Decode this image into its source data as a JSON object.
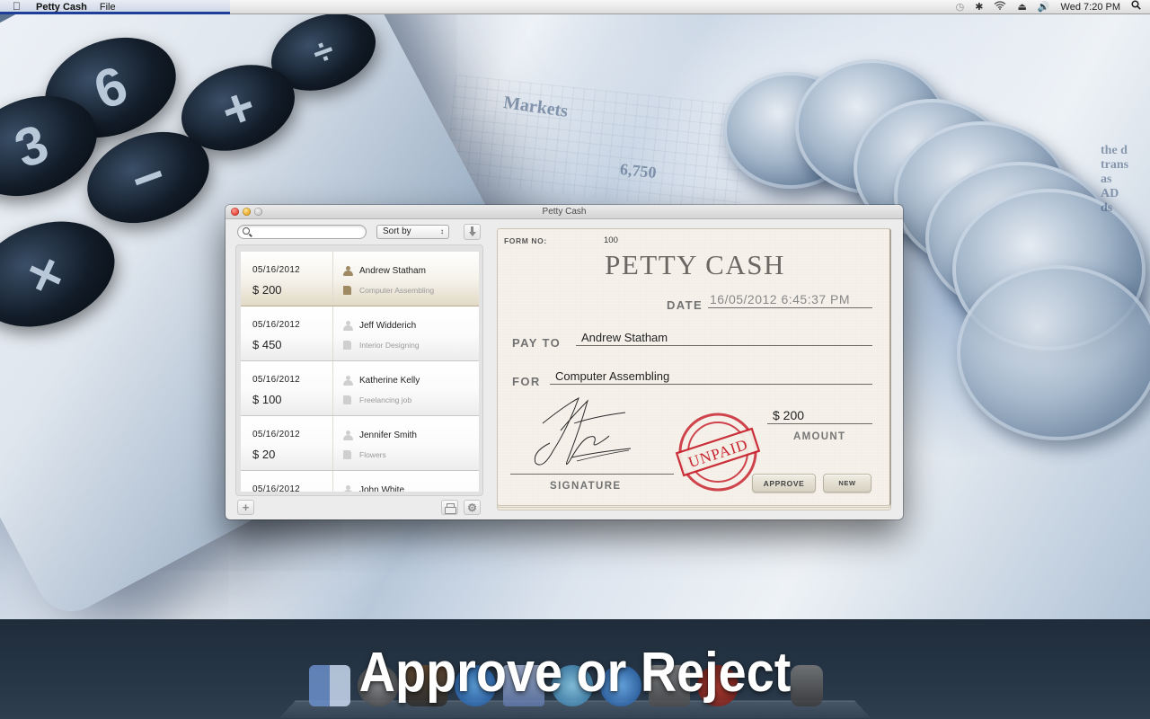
{
  "menubar": {
    "app_name": "Petty Cash",
    "menus": [
      "File"
    ],
    "status_icons": [
      "time-machine-icon",
      "bluetooth-icon",
      "wifi-icon",
      "eject-icon",
      "volume-icon"
    ],
    "clock": "Wed 7:20 PM",
    "spotlight_icon": "search-icon"
  },
  "window": {
    "title": "Petty Cash",
    "search": {
      "placeholder": "",
      "value": ""
    },
    "sort": {
      "selected": "Sort by"
    },
    "entries": [
      {
        "date": "05/16/2012",
        "amount": "$ 200",
        "name": "Andrew Statham",
        "memo": "Computer Assembling",
        "selected": true
      },
      {
        "date": "05/16/2012",
        "amount": "$ 450",
        "name": "Jeff Widderich",
        "memo": "Interior Designing",
        "selected": false
      },
      {
        "date": "05/16/2012",
        "amount": "$ 100",
        "name": "Katherine Kelly",
        "memo": "Freelancing job",
        "selected": false
      },
      {
        "date": "05/16/2012",
        "amount": "$ 20",
        "name": "Jennifer Smith",
        "memo": "Flowers",
        "selected": false
      },
      {
        "date": "05/16/2012",
        "amount": "",
        "name": "John White",
        "memo": "",
        "selected": false
      }
    ],
    "voucher": {
      "form_no_label": "FORM NO:",
      "form_no": "100",
      "title": "PETTY CASH",
      "date_label": "DATE",
      "date_value": "16/05/2012   6:45:37 PM",
      "pay_to_label": "PAY TO",
      "pay_to_value": "Andrew Statham",
      "for_label": "FOR",
      "for_value": "Computer Assembling",
      "amount_value": "$ 200",
      "amount_label": "AMOUNT",
      "signature_label": "SIGNATURE",
      "stamp_text": "UNPAID",
      "stamp_color": "#c8242f",
      "approve_label": "APPROVE",
      "new_label": "NEW"
    }
  },
  "caption": "Approve or Reject"
}
